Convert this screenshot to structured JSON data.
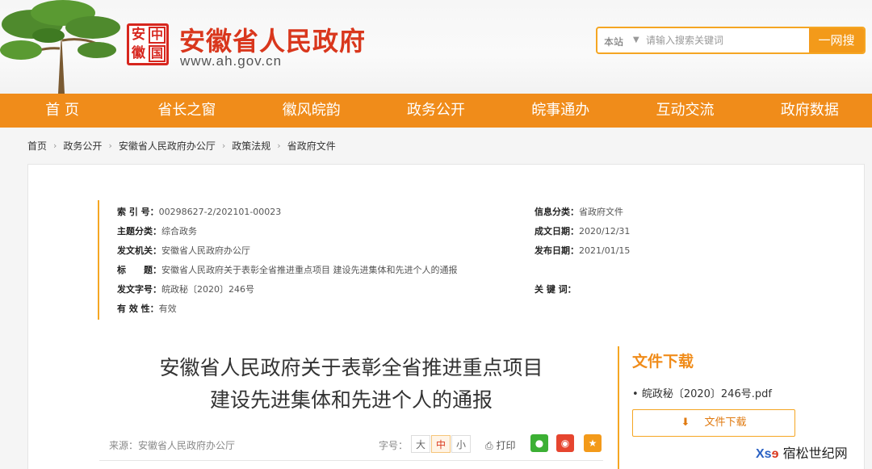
{
  "header": {
    "seal_chars": [
      "安",
      "中",
      "徽",
      "国"
    ],
    "site_title": "安徽省人民政府",
    "site_url": "www.ah.gov.cn"
  },
  "search": {
    "scope": "本站",
    "placeholder": "请输入搜索关键词",
    "button": "一网搜"
  },
  "nav": {
    "items": [
      "首 页",
      "省长之窗",
      "徽风皖韵",
      "政务公开",
      "皖事通办",
      "互动交流",
      "政府数据"
    ],
    "active_index": 3
  },
  "breadcrumb": [
    "首页",
    "政务公开",
    "安徽省人民政府办公厅",
    "政策法规",
    "省政府文件"
  ],
  "meta": {
    "index_no": {
      "k": "索 引 号：",
      "v": "00298627-2/202101-00023"
    },
    "topic": {
      "k": "主题分类：",
      "v": "综合政务"
    },
    "issuer": {
      "k": "发文机关：",
      "v": "安徽省人民政府办公厅"
    },
    "title": {
      "k": "标　　题：",
      "v": "安徽省人民政府关于表彰全省推进重点项目 建设先进集体和先进个人的通报"
    },
    "doc_no": {
      "k": "发文字号：",
      "v": "皖政秘〔2020〕246号"
    },
    "validity": {
      "k": "有 效 性：",
      "v": "有效"
    },
    "info_class": {
      "k": "信息分类：",
      "v": "省政府文件"
    },
    "created": {
      "k": "成文日期：",
      "v": "2020/12/31"
    },
    "published": {
      "k": "发布日期：",
      "v": "2021/01/15"
    },
    "keywords": {
      "k": "关 键 词：",
      "v": ""
    }
  },
  "doc": {
    "title_line1": "安徽省人民政府关于表彰全省推进重点项目",
    "title_line2": "建设先进集体和先进个人的通报",
    "source": "来源：安徽省人民政府办公厅",
    "font_size_label": "字号：",
    "font_sizes": [
      "大",
      "中",
      "小"
    ],
    "font_size_active": "中",
    "print": "打印"
  },
  "download": {
    "heading": "文件下载",
    "file": "皖政秘〔2020〕246号.pdf",
    "button": "文件下载"
  },
  "watermark": "宿松世纪网",
  "colors": {
    "brand_orange": "#f08c1a",
    "brand_red": "#d9371d",
    "wechat_green": "#3cb034",
    "weibo_red": "#e6452f",
    "star_orange": "#f39a1a"
  }
}
